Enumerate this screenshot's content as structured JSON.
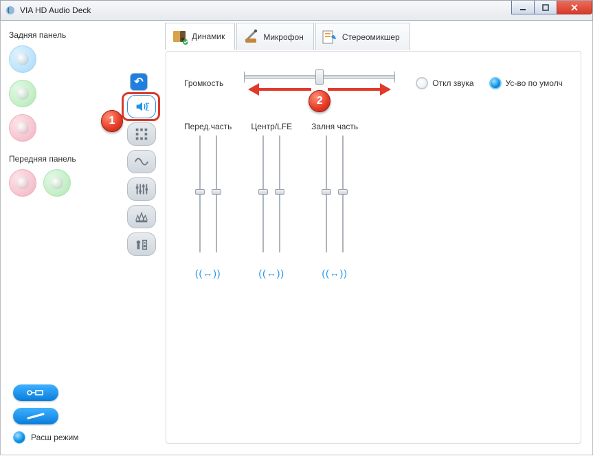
{
  "window": {
    "title": "VIA HD Audio Deck"
  },
  "left": {
    "rear_label": "Задняя панель",
    "front_label": "Передняя панель"
  },
  "mode": {
    "label": "Расш режим"
  },
  "tabs": [
    {
      "label": "Динамик"
    },
    {
      "label": "Микрофон"
    },
    {
      "label": "Стереомикшер"
    }
  ],
  "volume": {
    "label": "Громкость",
    "mute_label": "Откл звука",
    "default_label": "Ус-во по умолч"
  },
  "channels": [
    {
      "label": "Перед.часть"
    },
    {
      "label": "Центр/LFE"
    },
    {
      "label": "Залня часть"
    }
  ],
  "annotations": {
    "one": "1",
    "two": "2"
  },
  "balance_glyph": "((↔))"
}
